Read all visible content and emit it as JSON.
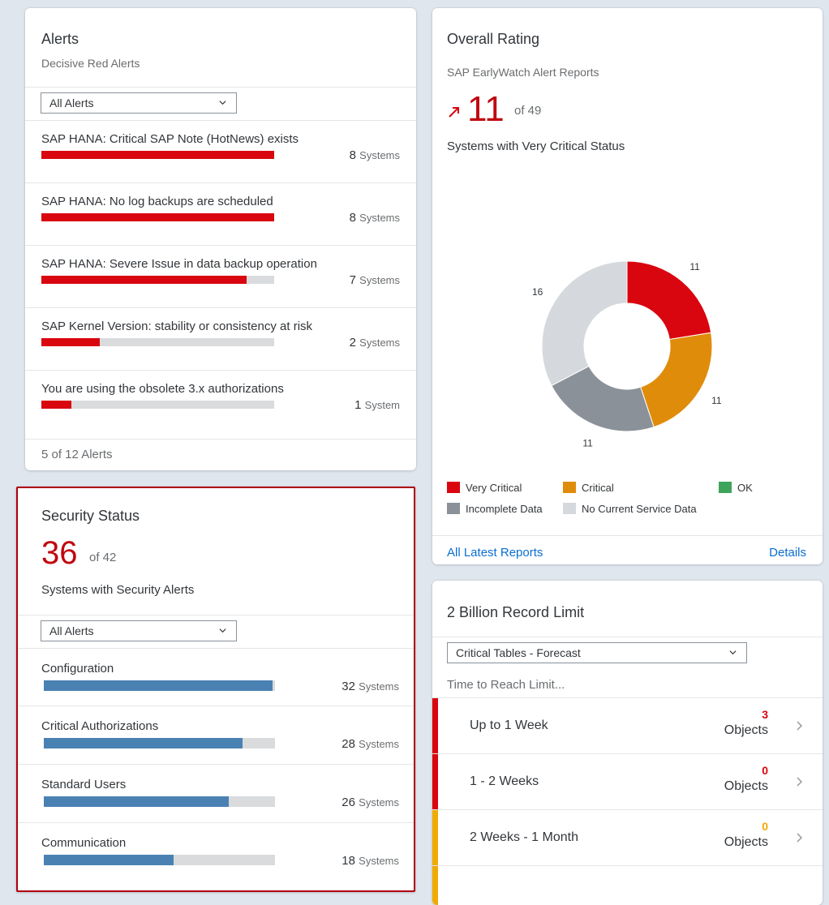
{
  "alerts_card": {
    "title": "Alerts",
    "subtitle": "Decisive Red Alerts",
    "filter": "All Alerts",
    "items": [
      {
        "label": "SAP HANA: Critical SAP Note (HotNews) exists",
        "count": "8",
        "unit": "Systems",
        "fill_pct": 100
      },
      {
        "label": "SAP HANA: No log backups are scheduled",
        "count": "8",
        "unit": "Systems",
        "fill_pct": 100
      },
      {
        "label": "SAP HANA: Severe Issue in data backup operation",
        "count": "7",
        "unit": "Systems",
        "fill_pct": 88
      },
      {
        "label": "SAP Kernel Version: stability or consistency at risk",
        "count": "2",
        "unit": "Systems",
        "fill_pct": 25
      },
      {
        "label": "You are using the obsolete 3.x authorizations",
        "count": "1",
        "unit": "System",
        "fill_pct": 13
      }
    ],
    "footer": "5 of 12 Alerts"
  },
  "rating_card": {
    "title": "Overall Rating",
    "subtitle": "SAP EarlyWatch Alert Reports",
    "kpi_value": "11",
    "kpi_of": "of 49",
    "kpi_desc": "Systems with Very Critical Status",
    "footer_left": "All Latest Reports",
    "footer_right": "Details"
  },
  "chart_data": {
    "type": "pie",
    "variant": "donut",
    "slices": [
      {
        "name": "Very Critical",
        "value": 11,
        "color": "#d9060f"
      },
      {
        "name": "Critical",
        "value": 11,
        "color": "#e08c0b"
      },
      {
        "name": "Incomplete Data",
        "value": 11,
        "color": "#8a9198"
      },
      {
        "name": "No Current Service Data",
        "value": 16,
        "color": "#d5d9dd"
      }
    ],
    "legend": [
      {
        "name": "Very Critical",
        "color": "#d9060f"
      },
      {
        "name": "Critical",
        "color": "#e08c0b"
      },
      {
        "name": "OK",
        "color": "#3fa45b"
      },
      {
        "name": "Incomplete Data",
        "color": "#8a9198"
      },
      {
        "name": "No Current Service Data",
        "color": "#d5d9dd"
      }
    ],
    "legend_position": "bottom"
  },
  "security_card": {
    "title": "Security Status",
    "kpi_value": "36",
    "kpi_of": "of 42",
    "kpi_desc": "Systems with Security Alerts",
    "filter": "All Alerts",
    "items": [
      {
        "label": "Configuration",
        "count": "32",
        "unit": "Systems",
        "fill_pct": 99
      },
      {
        "label": "Critical Authorizations",
        "count": "28",
        "unit": "Systems",
        "fill_pct": 86
      },
      {
        "label": "Standard Users",
        "count": "26",
        "unit": "Systems",
        "fill_pct": 80
      },
      {
        "label": "Communication",
        "count": "18",
        "unit": "Systems",
        "fill_pct": 56
      }
    ]
  },
  "record_card": {
    "title": "2 Billion Record Limit",
    "filter": "Critical Tables - Forecast",
    "section_label": "Time to Reach Limit...",
    "rows": [
      {
        "label": "Up to 1 Week",
        "count": "3",
        "unit": "Objects",
        "color": "#d9060f"
      },
      {
        "label": "1 - 2 Weeks",
        "count": "0",
        "unit": "Objects",
        "color": "#d9060f"
      },
      {
        "label": "2 Weeks - 1 Month",
        "count": "0",
        "unit": "Objects",
        "color": "#f0ab00"
      }
    ]
  },
  "colors": {
    "critical": "#d9060f",
    "warning": "#f0ab00",
    "accent": "#0a6ed1",
    "security_bar": "#4a81b3"
  }
}
